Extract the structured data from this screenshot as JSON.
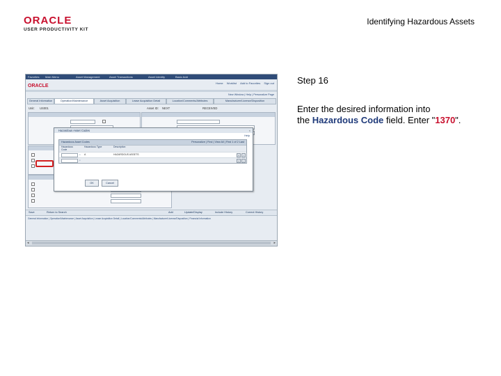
{
  "header": {
    "brand": "ORACLE",
    "brand_sub": "USER PRODUCTIVITY KIT",
    "title": "Identifying Hazardous Assets"
  },
  "instructions": {
    "step": "Step 16",
    "line1": "Enter the desired information into",
    "line2_prefix": "the ",
    "field_name": "Hazardous Code",
    "line2_mid": " field. Enter \"",
    "value": "1370",
    "line2_suffix": "\"."
  },
  "screenshot": {
    "brand": "ORACLE",
    "menu_items": [
      "Favorites",
      "Main Menu",
      "Asset Management",
      "Asset Transactions",
      "Asset Identity",
      "Basic Add"
    ],
    "top_links": [
      "Home",
      "Worklist",
      "Add to Favorites",
      "Sign out"
    ],
    "breadcrumb_links": [
      "New Window",
      "Help",
      "Personalize Page"
    ],
    "tabs": [
      "General Information",
      "Operation/Maintenance",
      "Asset Acquisition",
      "Lease Acquisition Detail",
      "Location/Comments/Attributes",
      "Manufacturer/License/Disposition"
    ],
    "info": {
      "unit_label": "Unit:",
      "unit_value": "US001",
      "asset_label": "Asset ID:",
      "asset_value": "NEXT",
      "status": "RECEIVED"
    },
    "bottom_bar": [
      "Save",
      "Return to Search",
      "Add",
      "Update/Display",
      "Include History",
      "Correct History"
    ],
    "footer": "General Information | Operation/Maintenance | Asset Acquisition | Lease Acquisition Detail | Location/Comments/Attributes | Manufacturer/License/Disposition | Financial Information",
    "modal": {
      "title": "Hazardous Asset Codes",
      "close": "×",
      "help": "Help",
      "grid_title": "Hazardous Asset Codes",
      "grid_nav": "Personalize | Find | View All | First 1 of 2 Last",
      "columns": [
        "Hazardous Code",
        "Hazardous Type",
        "Description"
      ],
      "rows": [
        {
          "code": "",
          "type": "A",
          "desc": "HAZARDOUS ASSETS"
        },
        {
          "code": "",
          "type": "",
          "desc": ""
        }
      ],
      "ok": "OK",
      "cancel": "Cancel"
    }
  }
}
